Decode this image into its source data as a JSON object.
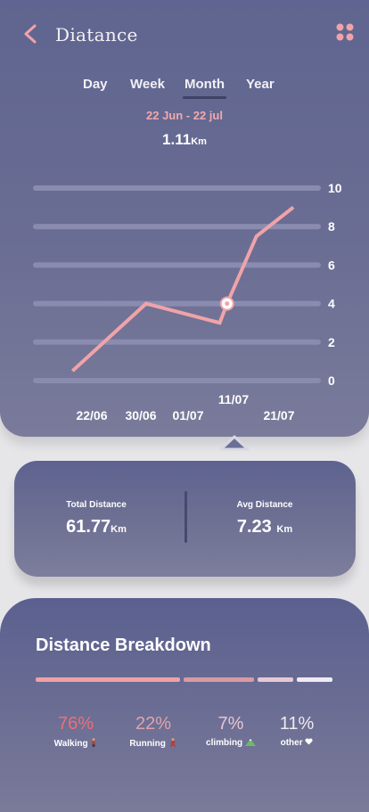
{
  "header": {
    "title": "Diatance"
  },
  "tabs": [
    {
      "label": "Day"
    },
    {
      "label": "Week"
    },
    {
      "label": "Month"
    },
    {
      "label": "Year"
    }
  ],
  "active_tab": "Month",
  "date_range": "22 Jun - 22 jul",
  "total": {
    "value": "1.11",
    "unit": "Km"
  },
  "chart_data": {
    "type": "line",
    "x_labels": [
      "22/06",
      "30/06",
      "01/07",
      "11/07",
      "21/07"
    ],
    "y_ticks": [
      "10",
      "8",
      "6",
      "4",
      "2",
      "0"
    ],
    "ylim": [
      0,
      10
    ],
    "grid": true,
    "points": [
      {
        "x": 1,
        "y": 0.5
      },
      {
        "x": 3,
        "y": 4.0
      },
      {
        "x": 5,
        "y": 3.0
      },
      {
        "x": 5.2,
        "y": 4.0
      },
      {
        "x": 6,
        "y": 7.5
      },
      {
        "x": 7,
        "y": 9.0
      }
    ],
    "highlight_index": 3,
    "line_color": "#f0a3a8"
  },
  "stats": {
    "total_label": "Total Distance",
    "total_value": "61.77",
    "total_unit": "Km",
    "avg_label": "Avg Distance",
    "avg_value": "7.23",
    "avg_unit": "Km"
  },
  "breakdown": {
    "title": "Distance Breakdown",
    "items": [
      {
        "percent": "76%",
        "label": "Walking",
        "icon": "walking-icon",
        "color": "#ee6f78"
      },
      {
        "percent": "22%",
        "label": "Running",
        "icon": "running-icon",
        "color": "#e0a3ab"
      },
      {
        "percent": "7%",
        "label": "climbing",
        "icon": "mountain-icon",
        "color": "#e8c6cf"
      },
      {
        "percent": "11%",
        "label": "other",
        "icon": "heart-icon",
        "color": "#eeeaf0"
      }
    ],
    "bar_colors": [
      "#f0a0a6",
      "#d99aa2",
      "#e6c9d2",
      "#efebf1"
    ]
  }
}
